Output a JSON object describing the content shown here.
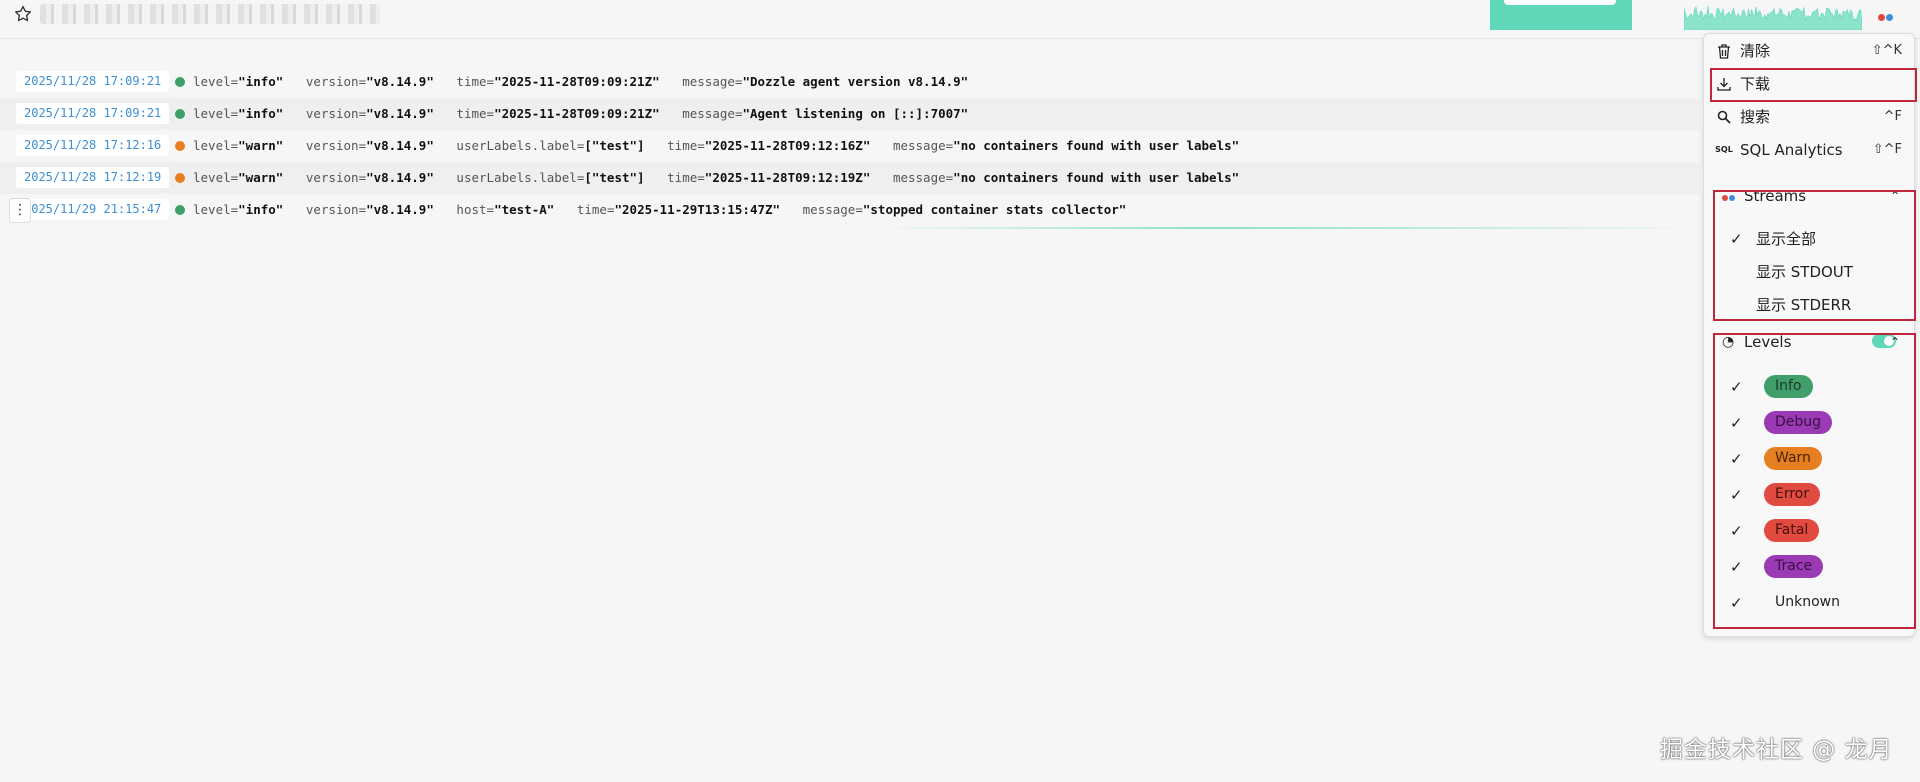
{
  "header": {
    "favorite_icon": "star-icon",
    "accent_color": "#5fd8b9"
  },
  "logs": [
    {
      "timestamp": "2025/11/28 17:09:21",
      "level_color": "#3f9e6a",
      "fields": [
        [
          "level",
          "\"info\""
        ],
        [
          "version",
          "\"v8.14.9\""
        ],
        [
          "time",
          "\"2025-11-28T09:09:21Z\""
        ],
        [
          "message",
          "\"Dozzle agent version v8.14.9\""
        ]
      ]
    },
    {
      "timestamp": "2025/11/28 17:09:21",
      "level_color": "#3f9e6a",
      "fields": [
        [
          "level",
          "\"info\""
        ],
        [
          "version",
          "\"v8.14.9\""
        ],
        [
          "time",
          "\"2025-11-28T09:09:21Z\""
        ],
        [
          "message",
          "\"Agent listening on [::]:7007\""
        ]
      ]
    },
    {
      "timestamp": "2025/11/28 17:12:16",
      "level_color": "#e67e22",
      "fields": [
        [
          "level",
          "\"warn\""
        ],
        [
          "version",
          "\"v8.14.9\""
        ],
        [
          "userLabels.label",
          "[\"test\"]"
        ],
        [
          "time",
          "\"2025-11-28T09:12:16Z\""
        ],
        [
          "message",
          "\"no containers found with user labels\""
        ]
      ]
    },
    {
      "timestamp": "2025/11/28 17:12:19",
      "level_color": "#e67e22",
      "fields": [
        [
          "level",
          "\"warn\""
        ],
        [
          "version",
          "\"v8.14.9\""
        ],
        [
          "userLabels.label",
          "[\"test\"]"
        ],
        [
          "time",
          "\"2025-11-28T09:12:19Z\""
        ],
        [
          "message",
          "\"no containers found with user labels\""
        ]
      ]
    },
    {
      "timestamp": "2025/11/29 21:15:47",
      "level_color": "#3f9e6a",
      "fields": [
        [
          "level",
          "\"info\""
        ],
        [
          "version",
          "\"v8.14.9\""
        ],
        [
          "host",
          "\"test-A\""
        ],
        [
          "time",
          "\"2025-11-29T13:15:47Z\""
        ],
        [
          "message",
          "\"stopped container stats collector\""
        ]
      ]
    }
  ],
  "menu": {
    "clear": {
      "label": "清除",
      "shortcut": "⇧^K",
      "icon": "trash-icon"
    },
    "download": {
      "label": "下载",
      "icon": "download-icon"
    },
    "search": {
      "label": "搜索",
      "shortcut": "^F",
      "icon": "search-icon"
    },
    "sql": {
      "label": "SQL Analytics",
      "shortcut": "⇧^F",
      "icon": "sql-icon"
    }
  },
  "streams": {
    "title": "Streams",
    "options": [
      {
        "label": "显示全部",
        "checked": true
      },
      {
        "label": "显示 STDOUT",
        "checked": false
      },
      {
        "label": "显示 STDERR",
        "checked": false
      }
    ]
  },
  "levels": {
    "title": "Levels",
    "toggle_on": true,
    "items": [
      {
        "label": "Info",
        "bg": "#3f9e6a",
        "fg": "#1d3b27",
        "checked": true
      },
      {
        "label": "Debug",
        "bg": "#9b3ab5",
        "fg": "#3a0f45",
        "checked": true
      },
      {
        "label": "Warn",
        "bg": "#e67e22",
        "fg": "#4a2606",
        "checked": true
      },
      {
        "label": "Error",
        "bg": "#e04a3f",
        "fg": "#4a0f0b",
        "checked": true
      },
      {
        "label": "Fatal",
        "bg": "#e04a3f",
        "fg": "#4a0f0b",
        "checked": true
      },
      {
        "label": "Trace",
        "bg": "#9b3ab5",
        "fg": "#3a0f45",
        "checked": true
      },
      {
        "label": "Unknown",
        "bg": "",
        "fg": "#222",
        "checked": true
      }
    ]
  },
  "watermark": "掘金技术社区 @ 龙月"
}
